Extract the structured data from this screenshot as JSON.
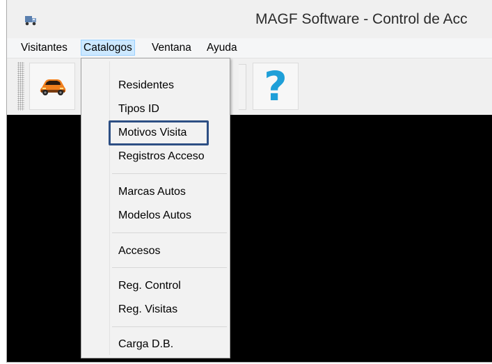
{
  "window": {
    "title": "MAGF Software - Control de Acc",
    "icon": "truck-icon"
  },
  "menubar": {
    "items": [
      {
        "label": "Visitantes"
      },
      {
        "label": "Catalogos",
        "open": true
      },
      {
        "label": "Ventana"
      },
      {
        "label": "Ayuda"
      }
    ]
  },
  "toolbar": {
    "buttons": [
      {
        "icon": "car-icon"
      },
      {
        "icon": "help-icon",
        "glyph": "?"
      }
    ]
  },
  "dropdown": {
    "groups": [
      [
        "Residentes",
        "Tipos ID",
        "Motivos Visita",
        "Registros Acceso"
      ],
      [
        "Marcas Autos",
        "Modelos Autos"
      ],
      [
        "Accesos"
      ],
      [
        "Reg. Control",
        "Reg. Visitas"
      ],
      [
        "Carga D.B."
      ]
    ],
    "highlighted_item": "Motivos Visita",
    "highlight_color": "#2d4f84"
  },
  "colors": {
    "menu_open_bg": "#cce8ff",
    "menu_open_border": "#99d1ff",
    "help_blue": "#1e9fd8",
    "car_orange": "#f07f1d",
    "content_bg": "#000000"
  }
}
